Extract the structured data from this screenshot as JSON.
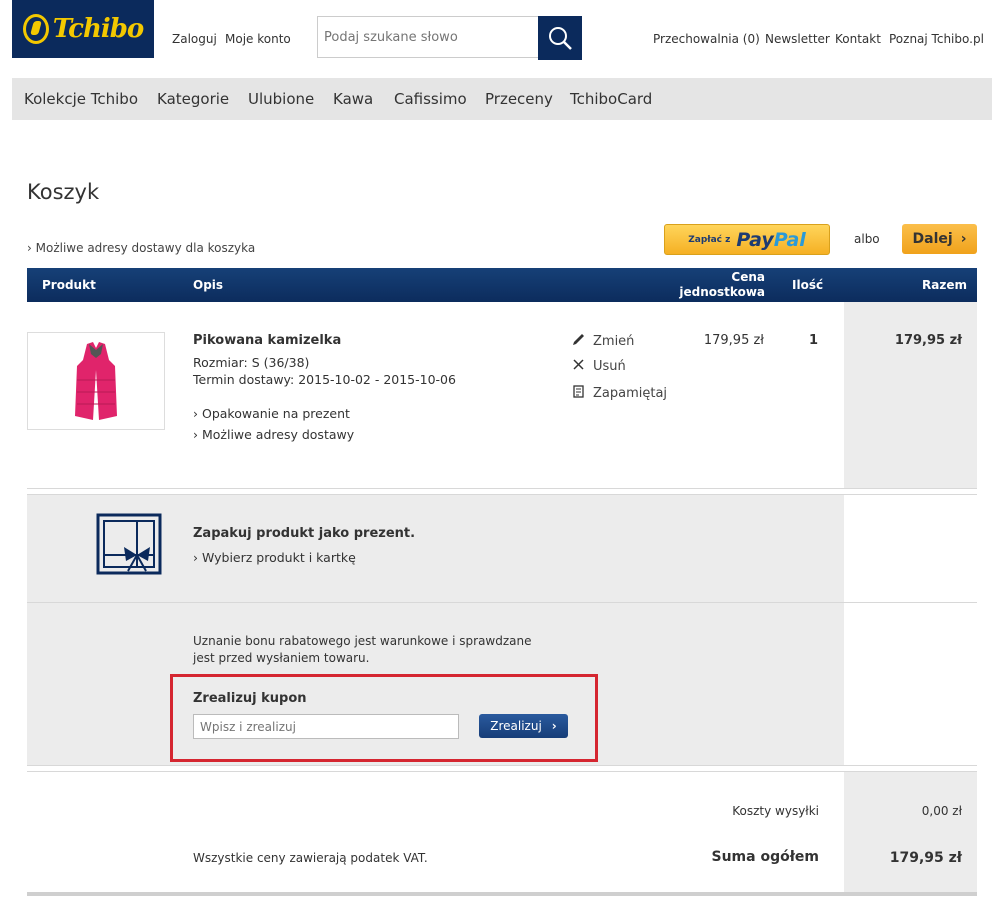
{
  "header": {
    "logo_text": "Tchibo",
    "links_left": [
      "Zaloguj",
      "Moje konto"
    ],
    "search_placeholder": "Podaj szukane słowo",
    "links_right": [
      "Przechowalnia (0)",
      "Newsletter",
      "Kontakt",
      "Poznaj Tchibo.pl"
    ]
  },
  "nav": [
    "Kolekcje Tchibo",
    "Kategorie",
    "Ulubione",
    "Kawa",
    "Cafissimo",
    "Przeceny",
    "TchiboCard"
  ],
  "cart": {
    "title": "Koszyk",
    "delivery_link": "Możliwe adresy dostawy dla koszyka",
    "paypal_small": "Zapłać z",
    "paypal_logo_a": "Pay",
    "paypal_logo_b": "Pal",
    "or_label": "albo",
    "next_label": "Dalej"
  },
  "table_header": {
    "product": "Produkt",
    "description": "Opis",
    "unit_price_line1": "Cena",
    "unit_price_line2": "jednostkowa",
    "quantity": "Ilość",
    "total": "Razem"
  },
  "item": {
    "name": "Pikowana kamizelka",
    "size": "Rozmiar: S (36/38)",
    "delivery": "Termin dostawy: 2015-10-02 - 2015-10-06",
    "link_gift": "Opakowanie na prezent",
    "link_delivery": "Możliwe adresy dostawy",
    "action_change": "Zmień",
    "action_remove": "Usuń",
    "action_save": "Zapamiętaj",
    "unit_price": "179,95 zł",
    "quantity": "1",
    "total": "179,95 zł",
    "image_color": "#e0246b"
  },
  "gift": {
    "title": "Zapakuj produkt jako prezent.",
    "link": "Wybierz produkt i kartkę"
  },
  "coupon": {
    "note_line1": "Uznanie bonu rabatowego jest warunkowe i sprawdzane",
    "note_line2": "jest przed wysłaniem towaru.",
    "title": "Zrealizuj kupon",
    "placeholder": "Wpisz i zrealizuj",
    "button": "Zrealizuj"
  },
  "summary": {
    "shipping_label": "Koszty wysyłki",
    "shipping_value": "0,00 zł",
    "vat_note": "Wszystkie ceny zawierają podatek VAT.",
    "total_label": "Suma ogółem",
    "total_value": "179,95 zł"
  },
  "colors": {
    "brand_navy": "#0b2a5c",
    "brand_yellow": "#f3c800",
    "highlight_red": "#d52630"
  }
}
